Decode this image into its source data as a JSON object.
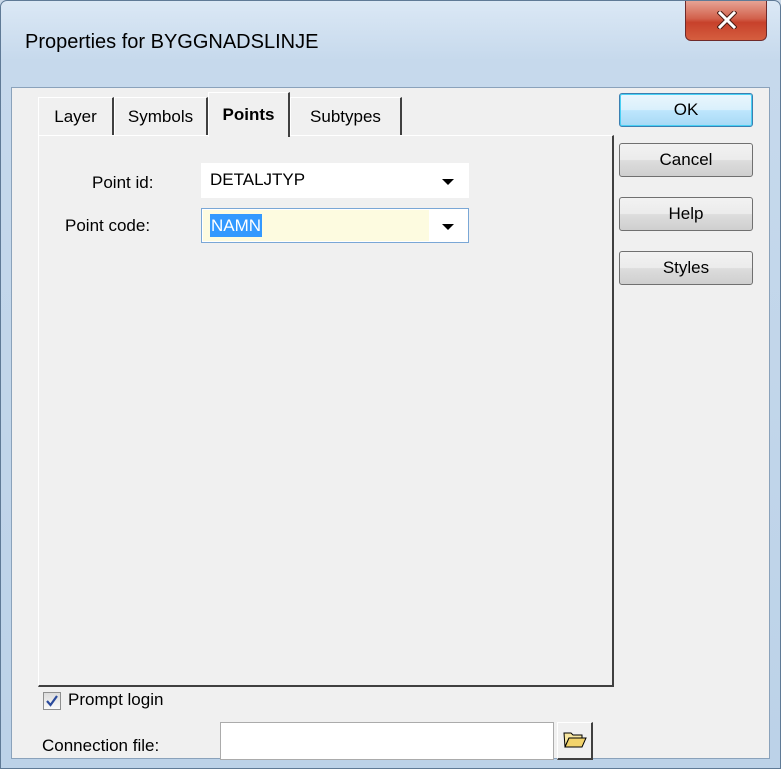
{
  "window": {
    "title": "Properties for BYGGNADSLINJE"
  },
  "tabs": [
    {
      "label": "Layer",
      "active": false
    },
    {
      "label": "Symbols",
      "active": false
    },
    {
      "label": "Points",
      "active": true
    },
    {
      "label": "Subtypes",
      "active": false
    }
  ],
  "points_tab": {
    "point_id_label": "Point id:",
    "point_id_value": "DETALJTYP",
    "point_code_label": "Point code:",
    "point_code_value": "NAMN"
  },
  "buttons": {
    "ok": "OK",
    "cancel": "Cancel",
    "help": "Help",
    "styles": "Styles"
  },
  "prompt_login": {
    "label": "Prompt login",
    "checked": true
  },
  "connection_file": {
    "label": "Connection file:",
    "value": ""
  },
  "icons": {
    "close": "close-icon",
    "checkmark": "checkmark-icon",
    "browse": "folder-open-icon",
    "dropdown": "chevron-down-icon"
  },
  "colors": {
    "selection": "#3399ff",
    "edit_background": "#fdfbe0",
    "close_button": "#c7412b"
  }
}
